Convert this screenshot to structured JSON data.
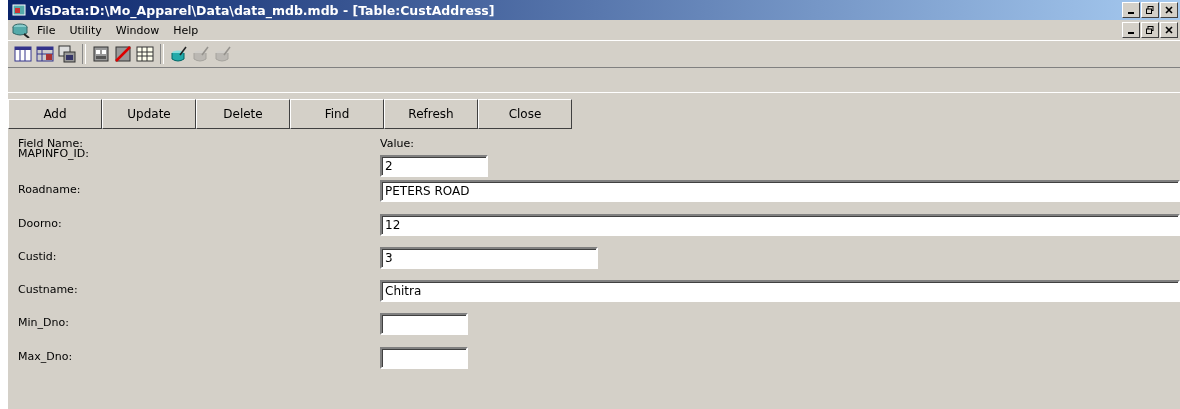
{
  "window": {
    "title": "VisData:D:\\Mo_Apparel\\Data\\data_mdb.mdb - [Table:CustAddress]"
  },
  "menu": [
    "File",
    "Utility",
    "Window",
    "Help"
  ],
  "toolbar": [
    {
      "kind": "table",
      "disabled": false
    },
    {
      "kind": "table2",
      "disabled": false
    },
    {
      "kind": "forms",
      "disabled": false
    },
    {
      "kind": "frame",
      "disabled": false
    },
    {
      "kind": "nogrid",
      "disabled": false
    },
    {
      "kind": "grid",
      "disabled": false
    },
    {
      "kind": "pot",
      "disabled": false
    },
    {
      "kind": "pot",
      "disabled": true
    },
    {
      "kind": "pot",
      "disabled": true
    }
  ],
  "buttons": [
    "Add",
    "Update",
    "Delete",
    "Find",
    "Refresh",
    "Close"
  ],
  "headers": {
    "field_name": "Field Name:",
    "value": "Value:"
  },
  "fields": [
    {
      "label": "MAPINFO_ID:",
      "value": "2"
    },
    {
      "label": "Roadname:",
      "value": "PETERS ROAD"
    },
    {
      "label": "Doorno:",
      "value": "12"
    },
    {
      "label": "Custid:",
      "value": "3"
    },
    {
      "label": "Custname:",
      "value": "Chitra"
    },
    {
      "label": "Min_Dno:"
    },
    {
      "label": "Max_Dno:"
    }
  ]
}
